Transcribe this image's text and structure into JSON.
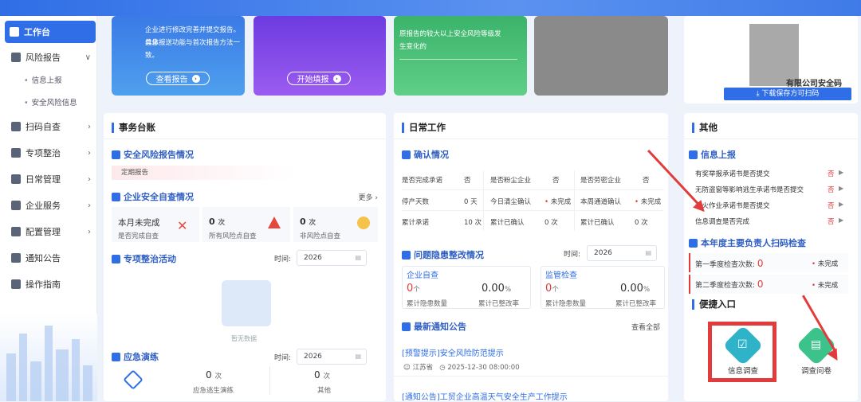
{
  "sidebar": {
    "items": [
      {
        "label": "工作台",
        "active": true
      },
      {
        "label": "风险报告",
        "chev": "∨"
      },
      {
        "label": "扫码自查",
        "chev": "›"
      },
      {
        "label": "专项整治",
        "chev": "›"
      },
      {
        "label": "日常管理",
        "chev": "›"
      },
      {
        "label": "企业服务",
        "chev": "›"
      },
      {
        "label": "配置管理",
        "chev": "›"
      },
      {
        "label": "通知公告"
      },
      {
        "label": "操作指南"
      }
    ],
    "sub": [
      "信息上报",
      "安全风险信息"
    ]
  },
  "banners": {
    "b1_text": [
      "企业进行修改完善并提交报告。具体",
      "信息报送功能与首次报告方法一致。"
    ],
    "b1_btn": "查看报告",
    "b2_btn": "开始填报",
    "b3_text": [
      "原报告的较大以上安全风险等级发",
      "生变化的"
    ]
  },
  "qr": {
    "company": "有限公司安全码",
    "download": "下载保存方可扫码"
  },
  "affairs": {
    "title": "事务台账",
    "risk_report": "安全风险报告情况",
    "regular": "定期报告",
    "self_check": "企业安全自查情况",
    "more": "更多 ›",
    "stats": [
      {
        "v": "本月未完成",
        "l": "是否完成自查"
      },
      {
        "v": "0",
        "u": "次",
        "l": "所有风险点自查"
      },
      {
        "v": "0",
        "u": "次",
        "l": "非风险点自查"
      }
    ],
    "special": "专项整治活动",
    "time_label": "时间:",
    "year": "2026",
    "no_data": "暂无数据",
    "drill": "应急演练",
    "drill_stats": [
      {
        "v": "0",
        "u": "次",
        "l": "应急逃生演练"
      },
      {
        "v": "0",
        "u": "次",
        "l": "其他"
      }
    ]
  },
  "daily": {
    "title": "日常工作",
    "confirm": "确认情况",
    "grid": [
      [
        "是否完成承诺",
        "否",
        "是否粉尘企业",
        "否",
        "是否劳密企业",
        "否"
      ],
      [
        "停产天数",
        "0 天",
        "今日清尘确认",
        "未完成",
        "本周通道确认",
        "未完成"
      ],
      [
        "累计承诺",
        "10 次",
        "累计已确认",
        "0 次",
        "累计已确认",
        "0 次"
      ]
    ],
    "rectify": "问题隐患整改情况",
    "time_label": "时间:",
    "year": "2026",
    "ent_check": "企业自查",
    "sup_check": "监管检查",
    "zero": "0",
    "unit_ge": "个",
    "rate": "0.00",
    "pct": "%",
    "hidden_count": "累计隐患数量",
    "rate_label": "累计已整改率",
    "notices_title": "最新通知公告",
    "view_all": "查看全部",
    "n1": "[预警提示]安全风险防范提示",
    "n1_src": "江苏省",
    "n1_time": "2025-12-30 08:00:00",
    "n2": "[通知公告]工贸企业高温天气安全生产工作提示"
  },
  "other": {
    "title": "其他",
    "info_report": "信息上报",
    "info_items": [
      "有奖举报承诺书是否提交",
      "无防盗窗等影响逃生承诺书是否提交",
      "动火作业承诺书是否提交",
      "信息调查是否完成"
    ],
    "no": "否",
    "annual": "本年度主要负责人扫码检查",
    "q1": "第一季度检查次数:",
    "q2": "第二季度检查次数:",
    "q_val": "0",
    "incomplete": "未完成",
    "quick": "便捷入口",
    "survey": "信息调查",
    "questionnaire": "调查问卷"
  }
}
